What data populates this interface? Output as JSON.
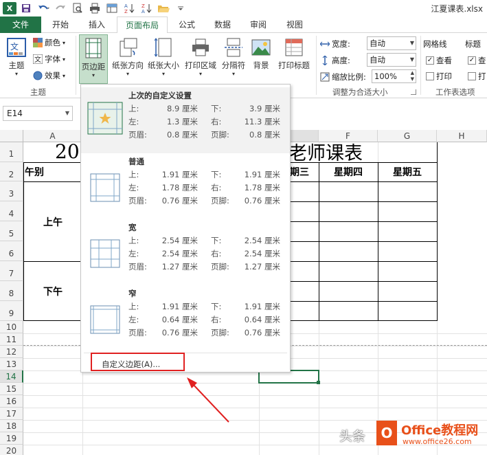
{
  "window": {
    "title": "江夏课表.xlsx"
  },
  "tabs": [
    "文件",
    "开始",
    "插入",
    "页面布局",
    "公式",
    "数据",
    "审阅",
    "视图"
  ],
  "ribbon": {
    "theme": {
      "big": "主题",
      "colors": "颜色",
      "fonts": "字体",
      "effects": "效果",
      "group": "主题"
    },
    "page_setup": {
      "margins": "页边距",
      "orientation": "纸张方向",
      "size": "纸张大小",
      "print_area": "打印区域",
      "breaks": "分隔符",
      "background": "背景",
      "print_titles": "打印标题"
    },
    "scale": {
      "width_label": "宽度:",
      "width_val": "自动",
      "height_label": "高度:",
      "height_val": "自动",
      "scale_label": "缩放比例:",
      "scale_val": "100%",
      "group": "调整为合适大小"
    },
    "sheet_options": {
      "gridlines": "网格线",
      "headings": "标题",
      "view": "查看",
      "print": "打印",
      "group": "工作表选项",
      "view2": "查",
      "print2": "打"
    }
  },
  "formula": {
    "namebox": "E14"
  },
  "sheet": {
    "columns": [
      "A",
      "E",
      "F",
      "G",
      "H"
    ],
    "rows": [
      "1",
      "2",
      "3",
      "4",
      "5",
      "6",
      "7",
      "8",
      "9",
      "10",
      "11",
      "12",
      "13",
      "14",
      "15",
      "16",
      "17",
      "18",
      "19",
      "20",
      "21",
      "22"
    ],
    "title_left": "20",
    "title_right": "老师课表",
    "header_left": "午别",
    "header_e": "期三",
    "header_f": "星期四",
    "header_g": "星期五",
    "morning": "上午",
    "afternoon": "下午"
  },
  "dropdown": {
    "presets": [
      {
        "name": "上次的自定义设置",
        "top": "8.9 厘米",
        "bottom": "3.9 厘米",
        "left": "1.3 厘米",
        "right": "11.3 厘米",
        "header": "0.8 厘米",
        "footer": "0.8 厘米"
      },
      {
        "name": "普通",
        "top": "1.91 厘米",
        "bottom": "1.91 厘米",
        "left": "1.78 厘米",
        "right": "1.78 厘米",
        "header": "0.76 厘米",
        "footer": "0.76 厘米"
      },
      {
        "name": "宽",
        "top": "2.54 厘米",
        "bottom": "2.54 厘米",
        "left": "2.54 厘米",
        "right": "2.54 厘米",
        "header": "1.27 厘米",
        "footer": "1.27 厘米"
      },
      {
        "name": "窄",
        "top": "1.91 厘米",
        "bottom": "1.91 厘米",
        "left": "0.64 厘米",
        "right": "0.64 厘米",
        "header": "0.76 厘米",
        "footer": "0.76 厘米"
      }
    ],
    "labels": {
      "top": "上:",
      "bottom": "下:",
      "left": "左:",
      "right": "右:",
      "header": "页眉:",
      "footer": "页脚:"
    },
    "custom": "自定义边距(A)..."
  },
  "watermark": {
    "a": "头条",
    "b": "Office教程网",
    "c": "www.office26.com",
    "d": "O"
  },
  "colors": {
    "excel_green": "#217346",
    "highlight_red": "#e02020",
    "watermark_orange": "#e8501a"
  }
}
